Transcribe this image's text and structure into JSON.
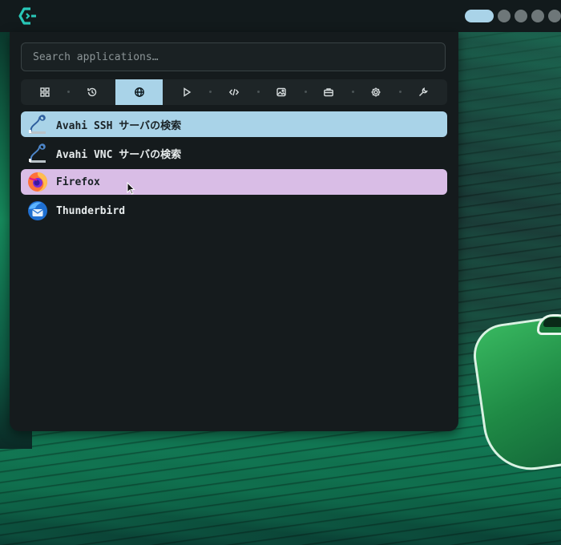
{
  "search": {
    "placeholder": "Search applications…",
    "value": ""
  },
  "tabs": [
    {
      "icon": "grid-icon",
      "active": false
    },
    {
      "icon": "history-icon",
      "active": false
    },
    {
      "icon": "globe-icon",
      "active": true
    },
    {
      "icon": "play-icon",
      "active": false
    },
    {
      "icon": "code-icon",
      "active": false
    },
    {
      "icon": "image-icon",
      "active": false
    },
    {
      "icon": "briefcase-icon",
      "active": false
    },
    {
      "icon": "settings-icon",
      "active": false
    },
    {
      "icon": "wrench-icon",
      "active": false
    }
  ],
  "apps": [
    {
      "label": "Avahi SSH サーバの検索",
      "icon": "avahi-icon",
      "state": "selected"
    },
    {
      "label": "Avahi VNC サーバの検索",
      "icon": "avahi-icon",
      "state": "normal"
    },
    {
      "label": "Firefox",
      "icon": "firefox-icon",
      "state": "hover"
    },
    {
      "label": "Thunderbird",
      "icon": "thunderbird-icon",
      "state": "normal"
    }
  ],
  "colors": {
    "accent": "#a9d3e8",
    "hover": "#d9bde6",
    "panel": "#151b1d"
  }
}
